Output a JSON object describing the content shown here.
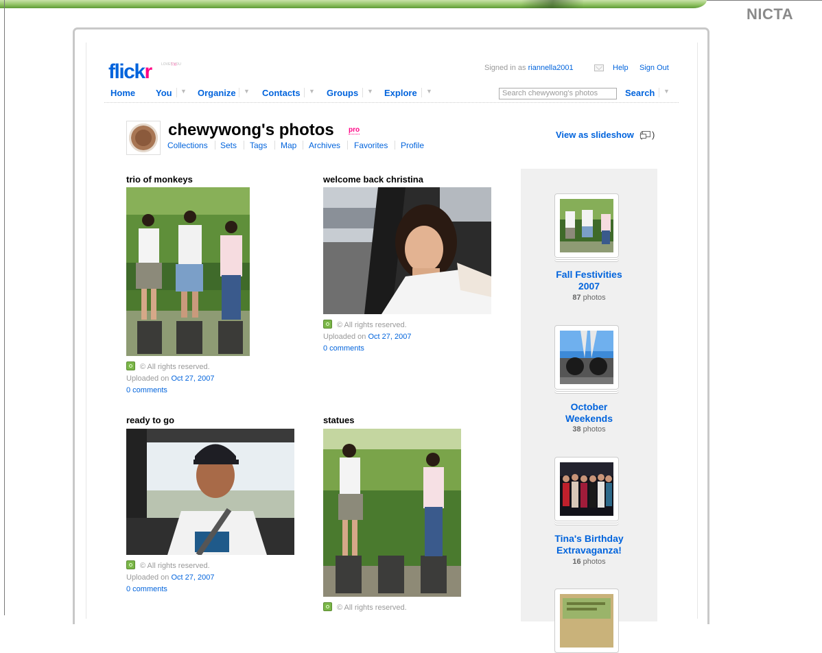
{
  "slide": {
    "brand": "NICTA"
  },
  "header": {
    "logo_main": "flick",
    "logo_r": "r",
    "logo_tagline": "LOVES YOU",
    "logo_tm": "TM",
    "signed_in_prefix": "Signed in as",
    "username": "riannella2001",
    "help": "Help",
    "sign_out": "Sign Out",
    "nav": [
      "Home",
      "You",
      "Organize",
      "Contacts",
      "Groups",
      "Explore"
    ],
    "search_placeholder": "Search chewywong's photos",
    "search_button": "Search"
  },
  "profile": {
    "title": "chewywong's photos",
    "pro": "pro",
    "subnav": [
      "Collections",
      "Sets",
      "Tags",
      "Map",
      "Archives",
      "Favorites",
      "Profile"
    ],
    "slideshow": "View as slideshow",
    "slideshow_paren_open": "(",
    "slideshow_paren_close": ")"
  },
  "photos": [
    {
      "title": "trio of monkeys",
      "rights": "© All rights reserved.",
      "uploaded_prefix": "Uploaded on",
      "date": "Oct 27, 2007",
      "comments": "0 comments"
    },
    {
      "title": "welcome back christina",
      "rights": "© All rights reserved.",
      "uploaded_prefix": "Uploaded on",
      "date": "Oct 27, 2007",
      "comments": "0 comments"
    },
    {
      "title": "ready to go",
      "rights": "© All rights reserved.",
      "uploaded_prefix": "Uploaded on",
      "date": "Oct 27, 2007",
      "comments": "0 comments"
    },
    {
      "title": "statues",
      "rights": "© All rights reserved."
    }
  ],
  "sets": [
    {
      "title_line1": "Fall Festivities",
      "title_line2": "2007",
      "count": "87",
      "unit": "photos"
    },
    {
      "title_line1": "October",
      "title_line2": "Weekends",
      "count": "38",
      "unit": "photos"
    },
    {
      "title_line1": "Tina's Birthday",
      "title_line2": "Extravaganza!",
      "count": "16",
      "unit": "photos"
    }
  ],
  "colors": {
    "flickr_blue": "#0063dc",
    "flickr_pink": "#ff0084",
    "banner_green": "#93c466"
  }
}
